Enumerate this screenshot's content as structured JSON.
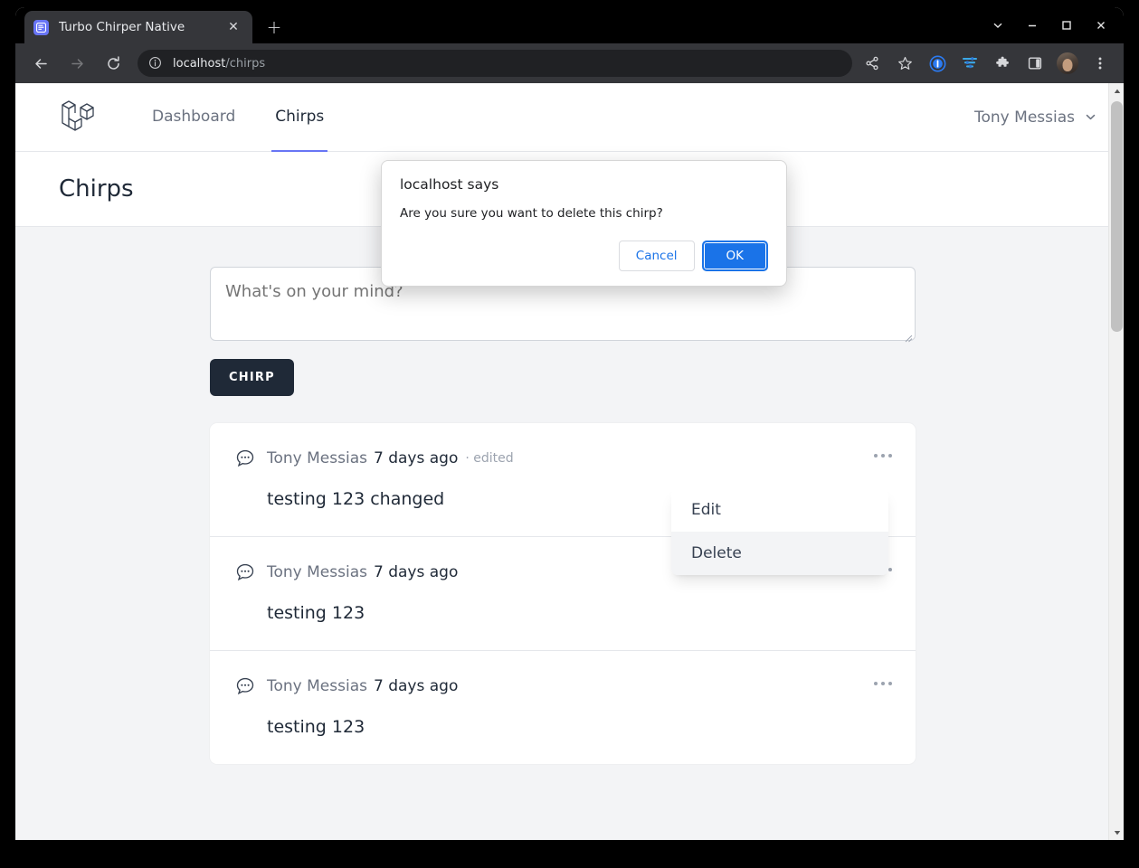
{
  "browser": {
    "tab": {
      "title": "Turbo Chirper Native",
      "favicon_name": "turbo-chirper-favicon",
      "close_label": "✕"
    },
    "new_tab_label": "+",
    "window_controls": {
      "chevron_label": "⌄",
      "minimize_label": "–",
      "maximize_label": "□",
      "close_label": "✕"
    },
    "nav": {
      "back_label": "←",
      "forward_label": "→",
      "reload_label": "⟳"
    },
    "omnibox": {
      "host": "localhost",
      "path": "/chirps",
      "info_icon": "info-circle-icon"
    },
    "toolbar_icons": [
      {
        "name": "share-icon"
      },
      {
        "name": "bookmark-star-icon"
      },
      {
        "name": "onepassword-icon"
      },
      {
        "name": "tune-filter-icon"
      },
      {
        "name": "extensions-puzzle-icon"
      },
      {
        "name": "side-panel-icon"
      },
      {
        "name": "profile-avatar-icon"
      },
      {
        "name": "chrome-menu-icon"
      }
    ]
  },
  "dialog": {
    "title": "localhost says",
    "message": "Are you sure you want to delete this chirp?",
    "cancel_label": "Cancel",
    "ok_label": "OK",
    "accent_color": "#1a73e8"
  },
  "app": {
    "logo_name": "laravel-logo",
    "nav_links": [
      {
        "label": "Dashboard",
        "active": false
      },
      {
        "label": "Chirps",
        "active": true
      }
    ],
    "user_name": "Tony Messias",
    "page_title": "Chirps",
    "accent_color": "#6875f5"
  },
  "compose": {
    "placeholder": "What's on your mind?",
    "value": "",
    "submit_label": "CHIRP"
  },
  "chirps": [
    {
      "author": "Tony Messias",
      "time": "7 days ago",
      "edited": "· edited",
      "message": "testing 123 changed"
    },
    {
      "author": "Tony Messias",
      "time": "7 days ago",
      "edited": "",
      "message": "testing 123"
    },
    {
      "author": "Tony Messias",
      "time": "7 days ago",
      "edited": "",
      "message": "testing 123"
    }
  ],
  "dropdown": {
    "edit_label": "Edit",
    "delete_label": "Delete"
  },
  "scrollbar": {
    "up_label": "▲",
    "down_label": "▼"
  }
}
